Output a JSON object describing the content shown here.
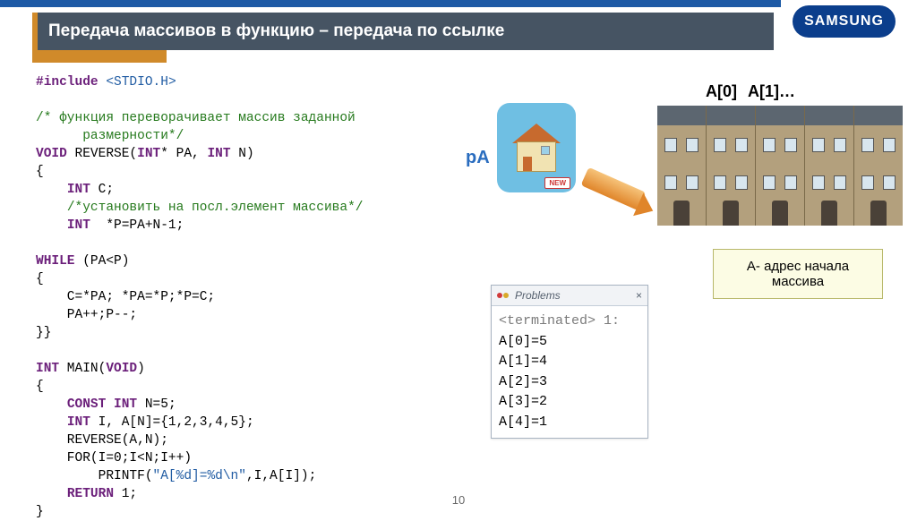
{
  "header": {
    "title": "Передача массивов в функцию – передача по ссылке",
    "logo_text": "SAMSUNG"
  },
  "code": {
    "lines": [
      {
        "t": "dir",
        "s": "#include"
      },
      {
        "t": "p",
        "s": " "
      },
      {
        "t": "str",
        "s": "<STDIO.H>"
      },
      {
        "t": "nl"
      },
      {
        "t": "nl"
      },
      {
        "t": "comment",
        "s": "/* функция переворачивает массив заданной"
      },
      {
        "t": "nl"
      },
      {
        "t": "comment",
        "s": "      размерности*/"
      },
      {
        "t": "nl"
      },
      {
        "t": "kw",
        "s": "VOID"
      },
      {
        "t": "p",
        "s": " REVERSE("
      },
      {
        "t": "kw",
        "s": "INT"
      },
      {
        "t": "p",
        "s": "* PA, "
      },
      {
        "t": "kw",
        "s": "INT"
      },
      {
        "t": "p",
        "s": " N)"
      },
      {
        "t": "nl"
      },
      {
        "t": "p",
        "s": "{"
      },
      {
        "t": "nl"
      },
      {
        "t": "p",
        "s": "    "
      },
      {
        "t": "kw",
        "s": "INT"
      },
      {
        "t": "p",
        "s": " C;"
      },
      {
        "t": "nl"
      },
      {
        "t": "p",
        "s": "    "
      },
      {
        "t": "comment",
        "s": "/*установить на посл.элемент массива*/"
      },
      {
        "t": "nl"
      },
      {
        "t": "p",
        "s": "    "
      },
      {
        "t": "kw",
        "s": "INT"
      },
      {
        "t": "p",
        "s": "  *P=PA+N-1;"
      },
      {
        "t": "nl"
      },
      {
        "t": "nl"
      },
      {
        "t": "kw",
        "s": "WHILE"
      },
      {
        "t": "p",
        "s": " (PA<P)"
      },
      {
        "t": "nl"
      },
      {
        "t": "p",
        "s": "{"
      },
      {
        "t": "nl"
      },
      {
        "t": "p",
        "s": "    C=*PA; *PA=*P;*P=C;"
      },
      {
        "t": "nl"
      },
      {
        "t": "p",
        "s": "    PA++;P--;"
      },
      {
        "t": "nl"
      },
      {
        "t": "p",
        "s": "}}"
      },
      {
        "t": "nl"
      },
      {
        "t": "nl"
      },
      {
        "t": "kw",
        "s": "INT"
      },
      {
        "t": "p",
        "s": " MAIN("
      },
      {
        "t": "kw",
        "s": "VOID"
      },
      {
        "t": "p",
        "s": ")"
      },
      {
        "t": "nl"
      },
      {
        "t": "p",
        "s": "{"
      },
      {
        "t": "nl"
      },
      {
        "t": "p",
        "s": "    "
      },
      {
        "t": "kw",
        "s": "CONST"
      },
      {
        "t": "p",
        "s": " "
      },
      {
        "t": "kw",
        "s": "INT"
      },
      {
        "t": "p",
        "s": " N=5;"
      },
      {
        "t": "nl"
      },
      {
        "t": "p",
        "s": "    "
      },
      {
        "t": "kw",
        "s": "INT"
      },
      {
        "t": "p",
        "s": " I, A[N]={1,2,3,4,5};"
      },
      {
        "t": "nl"
      },
      {
        "t": "p",
        "s": "    REVERSE(A,N);"
      },
      {
        "t": "nl"
      },
      {
        "t": "p",
        "s": "    FOR(I=0;I<N;I++)"
      },
      {
        "t": "nl"
      },
      {
        "t": "p",
        "s": "        PRINTF("
      },
      {
        "t": "str",
        "s": "\"A[%d]=%d\\n\""
      },
      {
        "t": "p",
        "s": ",I,A[I]);"
      },
      {
        "t": "nl"
      },
      {
        "t": "p",
        "s": "    "
      },
      {
        "t": "kw",
        "s": "RETURN"
      },
      {
        "t": "p",
        "s": " 1;"
      },
      {
        "t": "nl"
      },
      {
        "t": "p",
        "s": "}"
      }
    ]
  },
  "pointer_label": "pA",
  "array_labels": {
    "a0": "A[0]",
    "a1": "A[1]…"
  },
  "note_box": "A- адрес начала массива",
  "problems": {
    "tab": "Problems",
    "close": "×",
    "terminated": "<terminated> 1:",
    "rows": [
      "A[0]=5",
      "A[1]=4",
      "A[2]=3",
      "A[3]=2",
      "A[4]=1"
    ]
  },
  "badge_new": "NEW",
  "page_number": "10"
}
